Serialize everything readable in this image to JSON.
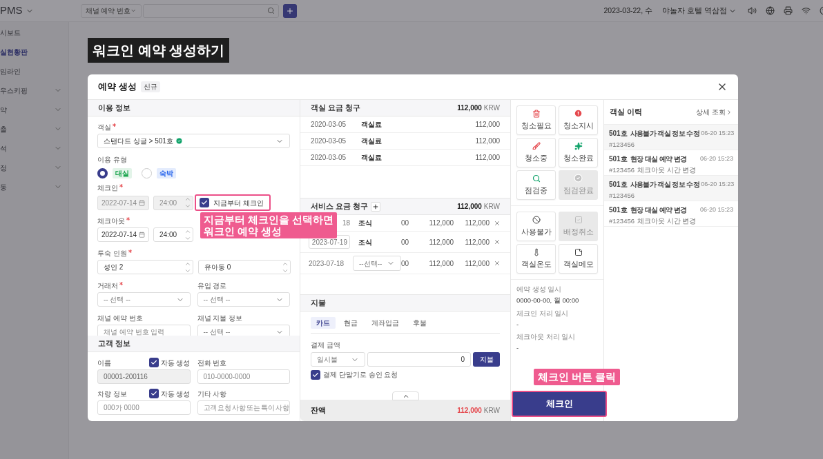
{
  "topbar": {
    "brand": "PMS",
    "channel_select": "채널 예약 번호",
    "date": "2023-03-22, 수",
    "hotel": "야놀자 호텔 역삼점"
  },
  "sidebar": {
    "items": [
      {
        "label": "시보드",
        "selected": false,
        "expandable": false
      },
      {
        "label": "실현황판",
        "selected": true,
        "expandable": false
      },
      {
        "label": "임라인",
        "selected": false,
        "expandable": false
      },
      {
        "label": "우스키핑",
        "selected": false,
        "expandable": true
      },
      {
        "label": "약",
        "selected": false,
        "expandable": true
      },
      {
        "label": "출",
        "selected": false,
        "expandable": true
      },
      {
        "label": "석",
        "selected": false,
        "expandable": true
      },
      {
        "label": "정",
        "selected": false,
        "expandable": true
      },
      {
        "label": "동",
        "selected": false,
        "expandable": true
      }
    ]
  },
  "guide_title": "워크인 예약 생성하기",
  "modal": {
    "title": "예약 생성",
    "badge": "신규"
  },
  "usage_info": {
    "title": "이용 정보",
    "room": {
      "label": "객실",
      "required": true,
      "value": "스탠다드 싱글 > 501호",
      "verified": true
    },
    "usage_type": {
      "label": "이용 유형",
      "options": [
        {
          "label": "대실",
          "selected": true,
          "color": "#16a34a"
        },
        {
          "label": "숙박",
          "selected": false,
          "color": "#2563eb"
        }
      ]
    },
    "checkin": {
      "label": "체크인",
      "required": true,
      "date": "2022-07-14",
      "time": "24:00",
      "disabled": true,
      "now": {
        "label": "지금부터 체크인",
        "checked": true,
        "highlighted": true
      }
    },
    "checkout": {
      "label": "체크아웃",
      "required": true,
      "date": "2022-07-14",
      "time": "24:00",
      "disabled": false
    },
    "guests": {
      "label": "투숙 인원",
      "required": true,
      "adults": "성인 2",
      "children": "유아동 0"
    },
    "partner": {
      "label": "거래처",
      "required": true,
      "placeholder": "-- 선택 --"
    },
    "inflow": {
      "label": "유입 경로",
      "placeholder": "-- 선택 --"
    },
    "channel_no": {
      "label": "채널 예약 번호",
      "placeholder": "채널 예약 번호 입력"
    },
    "channel_pay": {
      "label": "채널 지불 정보",
      "placeholder": "-- 선택 --"
    }
  },
  "guest_info": {
    "title": "고객 정보",
    "name": {
      "label": "이름",
      "auto": {
        "label": "자동 생성",
        "checked": true
      },
      "value": "00001-200116",
      "disabled": true
    },
    "phone": {
      "label": "전화 번호",
      "placeholder": "010-0000-0000"
    },
    "car": {
      "label": "차량 정보",
      "auto": {
        "label": "자동 생성",
        "checked": true
      },
      "placeholder": "000가 0000"
    },
    "note": {
      "label": "기타 사항",
      "placeholder": "고객 요청 사항 또는 특이 사항"
    }
  },
  "room_charges": {
    "title": "객실 요금 청구",
    "total": "112,000",
    "currency": "KRW",
    "rows": [
      {
        "date": "2020-03-05",
        "item": "객실료",
        "amount": "112,000"
      },
      {
        "date": "2020-03-05",
        "item": "객실료",
        "amount": "112,000"
      },
      {
        "date": "2020-03-05",
        "item": "객실료",
        "amount": "112,000"
      }
    ]
  },
  "service_charges": {
    "title": "서비스 요금 청구",
    "total": "112,000",
    "currency": "KRW",
    "rows": [
      {
        "kind": "text",
        "date": "18",
        "item": "조식",
        "qty": "00",
        "price": "112,000",
        "amount": "112,000"
      },
      {
        "kind": "input",
        "date": "2023-07-19",
        "item": "조식",
        "qty": "00",
        "price": "112,000",
        "amount": "112,000"
      },
      {
        "kind": "select",
        "date": "2023-07-18",
        "item": "--선택--",
        "qty": "00",
        "price": "112,000",
        "amount": "112,000"
      }
    ]
  },
  "payment": {
    "title": "지불",
    "tabs": [
      {
        "label": "카드",
        "selected": true
      },
      {
        "label": "현금",
        "selected": false
      },
      {
        "label": "계좌입금",
        "selected": false
      },
      {
        "label": "후불",
        "selected": false
      }
    ],
    "amount_label": "결제 금액",
    "installment": "일시불",
    "amount": "0",
    "pay_button": "지불",
    "terminal": {
      "label": "결제 단말기로 승인 요청",
      "checked": true
    }
  },
  "balance": {
    "label": "잔액",
    "amount": "112,000",
    "currency": "KRW"
  },
  "status_actions": [
    {
      "label": "청소필요",
      "disabled": false
    },
    {
      "label": "청소지시",
      "disabled": false
    },
    {
      "label": "청소중",
      "disabled": false
    },
    {
      "label": "청소완료",
      "disabled": false
    },
    {
      "label": "점검중",
      "disabled": false
    },
    {
      "label": "점검완료",
      "disabled": true
    }
  ],
  "room_actions": [
    {
      "label": "사용불가",
      "disabled": false
    },
    {
      "label": "배정취소",
      "disabled": true
    },
    {
      "label": "객실온도",
      "disabled": false
    },
    {
      "label": "객실메모",
      "disabled": false
    }
  ],
  "reservation_times": [
    {
      "label": "예약 생성 일시",
      "value": "0000-00-00, 월 00:00"
    },
    {
      "label": "체크인 처리 일시",
      "value": "-"
    },
    {
      "label": "체크아웃 처리 일시",
      "value": "-"
    }
  ],
  "checkin_button": {
    "label": "체크인",
    "highlighted": true
  },
  "history": {
    "title": "객실 이력",
    "detail_link": "상세 조회",
    "items": [
      {
        "room": "501호",
        "title": "사용불가 객실 정보 수정",
        "time": "06-20 15:23",
        "id": "#123456"
      },
      {
        "room": "501호",
        "title": "현장 대실 예약 변경",
        "time": "06-20 15:23",
        "id": "#123456",
        "note": "체크아웃 시간 변경"
      },
      {
        "room": "501호",
        "title": "사용불가 객실 정보 수정",
        "time": "06-20 15:23",
        "id": "#123456"
      },
      {
        "room": "501호",
        "title": "현장 대실 예약 변경",
        "time": "06-20 15:23",
        "id": "#123456",
        "note": "체크아웃 시간 변경"
      }
    ]
  },
  "annotations": [
    {
      "text": "지금부터 체크인을 선택하면\n워크인 예약 생성"
    },
    {
      "text": "체크인 버튼 클릭"
    }
  ]
}
